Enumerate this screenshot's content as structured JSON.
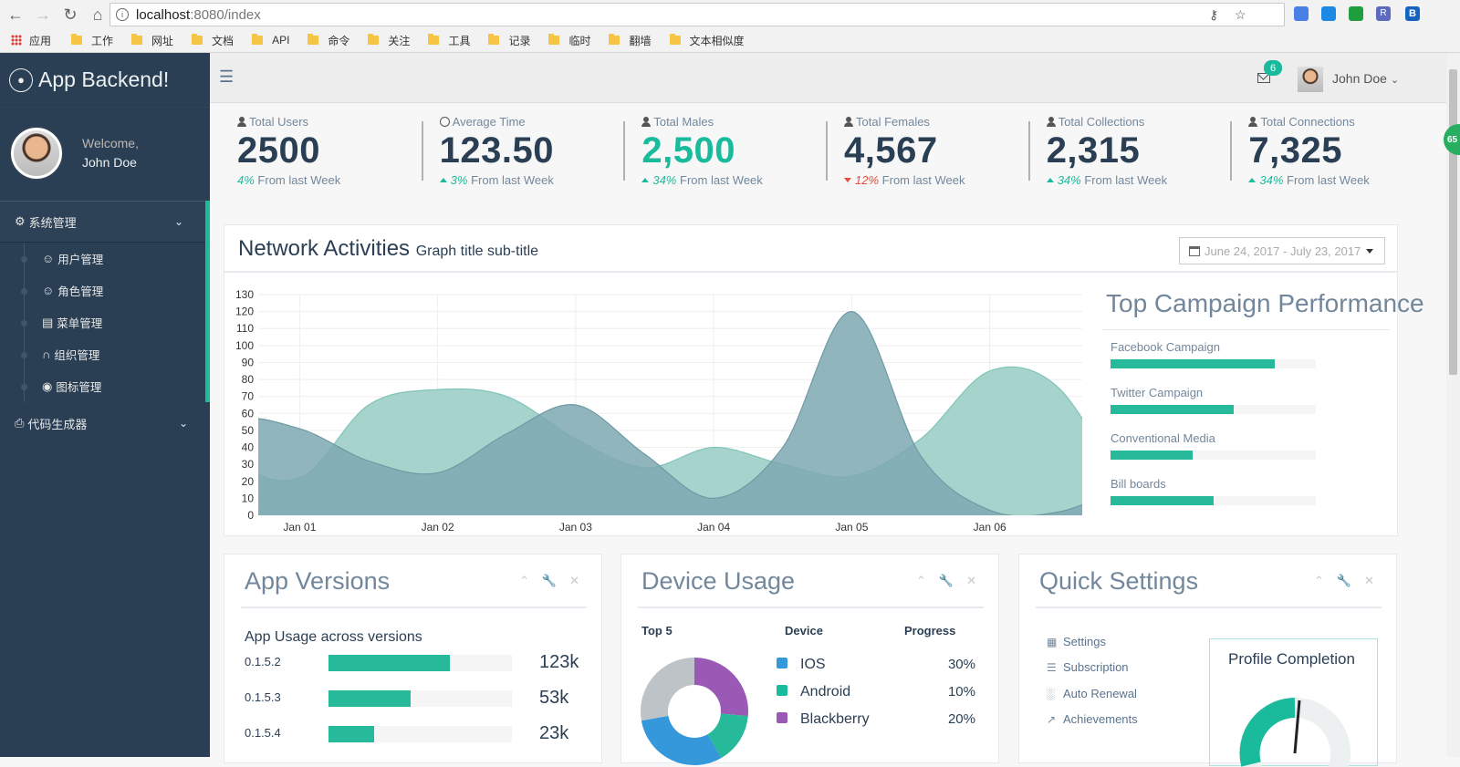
{
  "browser": {
    "url_host": "localhost",
    "url_path": ":8080/index",
    "bookmarks": [
      "应用",
      "工作",
      "网址",
      "文档",
      "API",
      "命令",
      "关注",
      "工具",
      "记录",
      "临时",
      "翻墙",
      "文本相似度"
    ],
    "extension_labels": [
      "",
      "",
      "",
      "R",
      "B"
    ]
  },
  "sidebar": {
    "brand": "App Backend!",
    "welcome": "Welcome,",
    "user": "John Doe",
    "sections": [
      {
        "label": "系统管理",
        "items": [
          {
            "label": "用户管理",
            "icon": "user-icon"
          },
          {
            "label": "角色管理",
            "icon": "user-icon"
          },
          {
            "label": "菜单管理",
            "icon": "book-icon"
          },
          {
            "label": "组织管理",
            "icon": "org-icon"
          },
          {
            "label": "图标管理",
            "icon": "globe-icon"
          }
        ]
      },
      {
        "label": "代码生成器",
        "items": []
      }
    ]
  },
  "topnav": {
    "mail_count": "6",
    "user": "John Doe"
  },
  "stats": [
    {
      "label": "Total Users",
      "value": "2500",
      "pct": "4%",
      "suffix": "From last Week",
      "trend": "none",
      "highlight": false,
      "icon": "user-icon"
    },
    {
      "label": "Average Time",
      "value": "123.50",
      "pct": "3%",
      "suffix": "From last Week",
      "trend": "up",
      "highlight": false,
      "icon": "clock-icon"
    },
    {
      "label": "Total Males",
      "value": "2,500",
      "pct": "34%",
      "suffix": "From last Week",
      "trend": "up",
      "highlight": true,
      "icon": "user-icon"
    },
    {
      "label": "Total Females",
      "value": "4,567",
      "pct": "12%",
      "suffix": "From last Week",
      "trend": "down",
      "highlight": false,
      "icon": "user-icon"
    },
    {
      "label": "Total Collections",
      "value": "2,315",
      "pct": "34%",
      "suffix": "From last Week",
      "trend": "up",
      "highlight": false,
      "icon": "user-icon"
    },
    {
      "label": "Total Connections",
      "value": "7,325",
      "pct": "34%",
      "suffix": "From last Week",
      "trend": "up",
      "highlight": false,
      "icon": "user-icon"
    }
  ],
  "network": {
    "title": "Network Activities",
    "subtitle": "Graph title sub-title",
    "date_range": "June 24, 2017 - July 23, 2017"
  },
  "chart_data": {
    "type": "area",
    "x": [
      0,
      0.5,
      1,
      1.5,
      2,
      2.5,
      3,
      3.5,
      4,
      4.5,
      5,
      5.5,
      6,
      6.5,
      7
    ],
    "xticks": [
      "Jan 01",
      "Jan 02",
      "Jan 03",
      "Jan 04",
      "Jan 05",
      "Jan 06"
    ],
    "yticks": [
      0,
      10,
      20,
      30,
      40,
      50,
      60,
      70,
      80,
      90,
      100,
      110,
      120,
      130
    ],
    "ylim": [
      0,
      130
    ],
    "xlim": [
      0.7,
      6.67
    ],
    "colors": [
      "#96ccc4",
      "#7ea8b1"
    ],
    "series": [
      {
        "values": [
          120,
          38,
          22,
          65,
          74,
          70,
          45,
          28,
          40,
          30,
          23,
          45,
          85,
          75,
          10
        ]
      },
      {
        "values": [
          20,
          55,
          51,
          32,
          25,
          48,
          65,
          36,
          10,
          40,
          120,
          35,
          3,
          2,
          18
        ]
      }
    ]
  },
  "campaigns": {
    "title": "Top Campaign Performance",
    "items": [
      {
        "label": "Facebook Campaign",
        "value": 0.8
      },
      {
        "label": "Twitter Campaign",
        "value": 0.6
      },
      {
        "label": "Conventional Media",
        "value": 0.4
      },
      {
        "label": "Bill boards",
        "value": 0.5
      }
    ]
  },
  "app_versions": {
    "title": "App Versions",
    "subtitle": "App Usage across versions",
    "rows": [
      {
        "version": "0.1.5.2",
        "fill": 0.66,
        "value": "123k"
      },
      {
        "version": "0.1.5.3",
        "fill": 0.45,
        "value": "53k"
      },
      {
        "version": "0.1.5.4",
        "fill": 0.25,
        "value": "23k"
      }
    ]
  },
  "device_usage": {
    "title": "Device Usage",
    "col_top": "Top 5",
    "col_device": "Device",
    "col_progress": "Progress",
    "rows": [
      {
        "name": "IOS",
        "pct": "30%",
        "color": "#3498db"
      },
      {
        "name": "Android",
        "pct": "10%",
        "color": "#1abb9c"
      },
      {
        "name": "Blackberry",
        "pct": "20%",
        "color": "#9b59b6"
      }
    ]
  },
  "quick_settings": {
    "title": "Quick Settings",
    "links": [
      {
        "label": "Settings",
        "icon": "calendar-icon"
      },
      {
        "label": "Subscription",
        "icon": "list-icon"
      },
      {
        "label": "Auto Renewal",
        "icon": "bar-chart-icon"
      },
      {
        "label": "Achievements",
        "icon": "line-chart-icon"
      }
    ],
    "profile_title": "Profile Completion"
  },
  "floating_badge": "65"
}
